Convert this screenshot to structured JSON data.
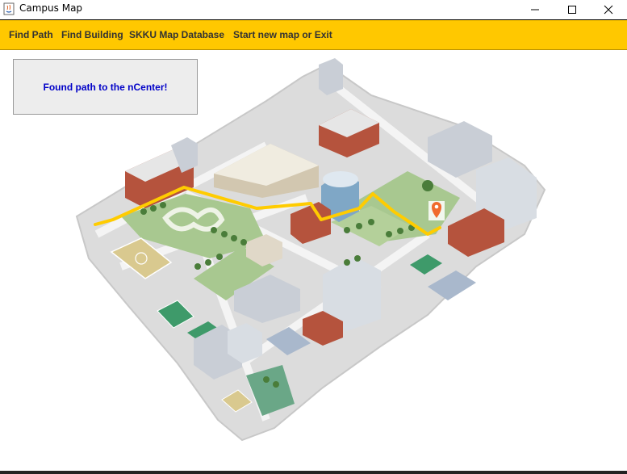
{
  "window": {
    "title": "Campus Map",
    "icon": "java-coffee-icon"
  },
  "window_controls": [
    "minimize-icon",
    "maximize-icon",
    "close-icon"
  ],
  "menu": {
    "items": [
      {
        "label": "Find Path"
      },
      {
        "label": "Find Building"
      },
      {
        "label": "SKKU Map Database"
      },
      {
        "label": "Start new map or Exit"
      }
    ]
  },
  "status": {
    "message": "Found path to the nCenter!"
  },
  "map": {
    "route_color": "#ffcc00",
    "destination_marker": "location-pin-icon",
    "marker_color": "#f06a2c"
  }
}
